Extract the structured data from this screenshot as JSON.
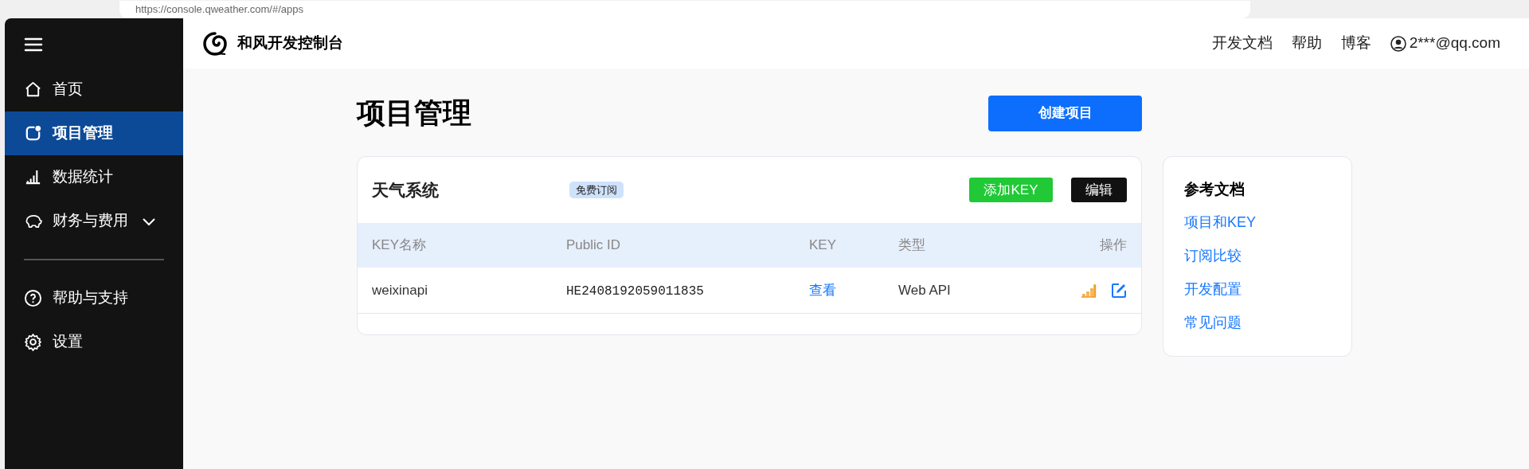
{
  "browser": {
    "url": "https://console.qweather.com/#/apps"
  },
  "header": {
    "title": "和风开发控制台",
    "links": [
      "开发文档",
      "帮助",
      "博客"
    ],
    "account": "2***@qq.com"
  },
  "sidebar": {
    "items": [
      {
        "kind": "home",
        "label": "首页",
        "selected": false
      },
      {
        "kind": "project",
        "label": "项目管理",
        "selected": true
      },
      {
        "kind": "stats",
        "label": "数据统计",
        "selected": false
      },
      {
        "kind": "finance",
        "label": "财务与费用",
        "selected": false,
        "expanded": false
      },
      {
        "kind": "divider"
      },
      {
        "kind": "help",
        "label": "帮助与支持",
        "selected": false
      },
      {
        "kind": "settings",
        "label": "设置",
        "selected": false
      }
    ]
  },
  "page": {
    "title": "项目管理",
    "create_button": "创建项目"
  },
  "project": {
    "name": "天气系统",
    "badge": "免费订阅",
    "add_button": "添加KEY",
    "edit_button": "编辑",
    "columns": [
      "KEY名称",
      "Public ID",
      "KEY",
      "类型",
      "操作"
    ],
    "rows": [
      {
        "name": "weixinapi",
        "public_id": "HE2408192059011835",
        "key": "查看",
        "type": "Web API"
      }
    ]
  },
  "docs": {
    "title": "参考文档",
    "links": [
      "项目和KEY",
      "订阅比较",
      "开发配置",
      "常见问题"
    ]
  }
}
